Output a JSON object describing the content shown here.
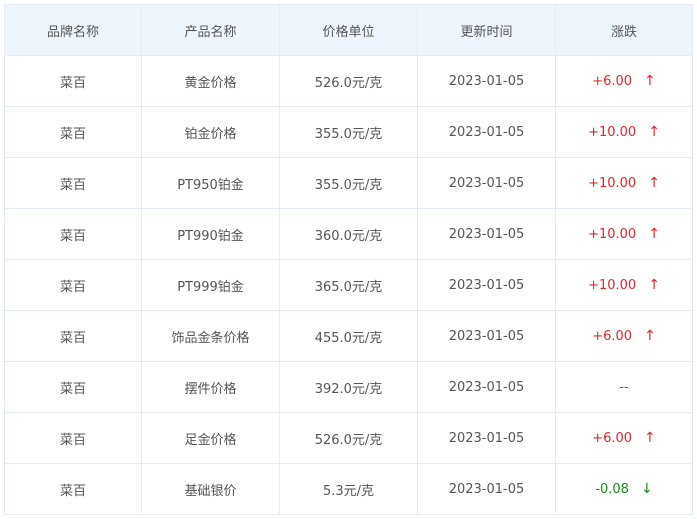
{
  "colors": {
    "header_bg": "#eef5fc",
    "border": "#e3ecf4",
    "text": "#555555",
    "up": "#e0262a",
    "down": "#1f8a1f",
    "flat": "#555555"
  },
  "table": {
    "headers": [
      "品牌名称",
      "产品名称",
      "价格单位",
      "更新时间",
      "涨跌"
    ],
    "rows": [
      {
        "brand": "菜百",
        "product": "黄金价格",
        "price": "526.0元/克",
        "date": "2023-01-05",
        "change": "+6.00",
        "trend": "up",
        "arrow": "↑"
      },
      {
        "brand": "菜百",
        "product": "铂金价格",
        "price": "355.0元/克",
        "date": "2023-01-05",
        "change": "+10.00",
        "trend": "up",
        "arrow": "↑"
      },
      {
        "brand": "菜百",
        "product": "PT950铂金",
        "price": "355.0元/克",
        "date": "2023-01-05",
        "change": "+10.00",
        "trend": "up",
        "arrow": "↑"
      },
      {
        "brand": "菜百",
        "product": "PT990铂金",
        "price": "360.0元/克",
        "date": "2023-01-05",
        "change": "+10.00",
        "trend": "up",
        "arrow": "↑"
      },
      {
        "brand": "菜百",
        "product": "PT999铂金",
        "price": "365.0元/克",
        "date": "2023-01-05",
        "change": "+10.00",
        "trend": "up",
        "arrow": "↑"
      },
      {
        "brand": "菜百",
        "product": "饰品金条价格",
        "price": "455.0元/克",
        "date": "2023-01-05",
        "change": "+6.00",
        "trend": "up",
        "arrow": "↑"
      },
      {
        "brand": "菜百",
        "product": "摆件价格",
        "price": "392.0元/克",
        "date": "2023-01-05",
        "change": "--",
        "trend": "flat",
        "arrow": ""
      },
      {
        "brand": "菜百",
        "product": "足金价格",
        "price": "526.0元/克",
        "date": "2023-01-05",
        "change": "+6.00",
        "trend": "up",
        "arrow": "↑"
      },
      {
        "brand": "菜百",
        "product": "基础银价",
        "price": "5.3元/克",
        "date": "2023-01-05",
        "change": "-0.08",
        "trend": "down",
        "arrow": "↓"
      }
    ]
  }
}
